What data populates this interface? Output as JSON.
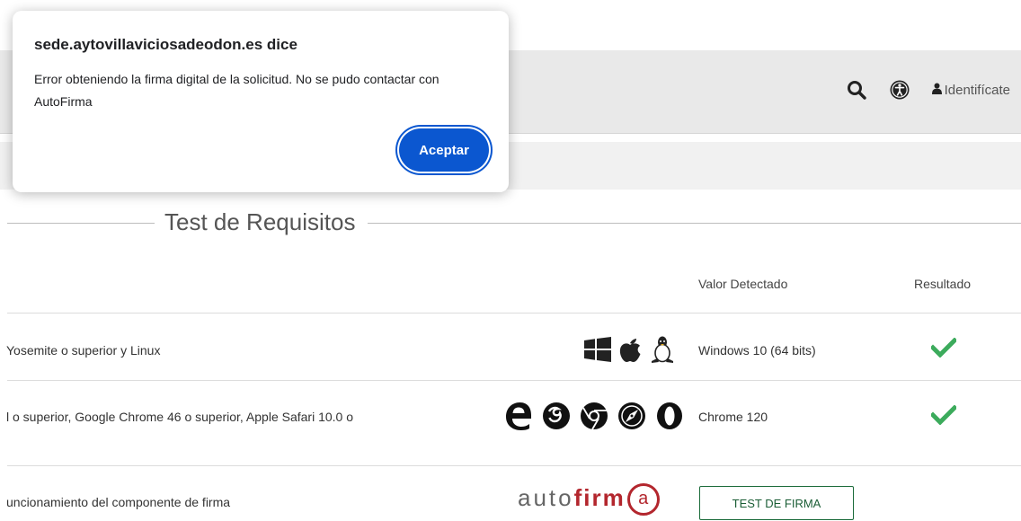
{
  "header": {
    "login_label": "Identifícate"
  },
  "section": {
    "title": "Test de Requisitos"
  },
  "table": {
    "columns": [
      "Valor Detectado",
      "Resultado"
    ],
    "rows": [
      {
        "requirement": "Yosemite o superior y Linux",
        "detected": "Windows 10 (64 bits)",
        "result_icon": "check-icon"
      },
      {
        "requirement": "l o superior, Google Chrome 46 o superior, Apple Safari 10.0 o",
        "detected": "Chrome 120",
        "result_icon": "check-icon"
      },
      {
        "requirement": "uncionamiento del componente de firma",
        "logo_text_light": "auto",
        "logo_text_bold": "firm",
        "logo_at": "a",
        "action_label": "TEST DE FIRMA"
      }
    ]
  },
  "dialog": {
    "title": "sede.aytovillaviciosadeodon.es dice",
    "message": "Error obteniendo la firma digital de la solicitud. No se pudo contactar con AutoFirma",
    "accept_label": "Aceptar"
  },
  "colors": {
    "success": "#3cab5c",
    "primary_button": "#0b57d0",
    "autofirma_red": "#b3262d"
  }
}
